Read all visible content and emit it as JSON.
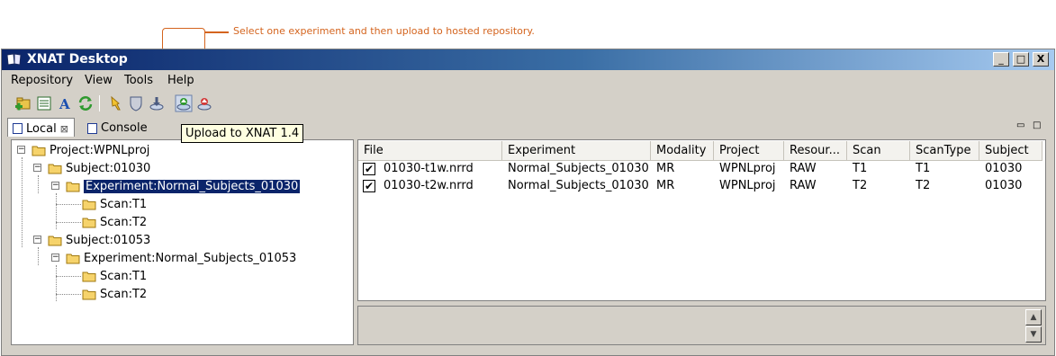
{
  "annotation": {
    "text": "Select one experiment and then upload to hosted repository."
  },
  "window": {
    "title": "XNAT Desktop",
    "controls": [
      "_",
      "□",
      "X"
    ]
  },
  "menu": [
    "Repository",
    "View",
    "Tools",
    "Help"
  ],
  "toolbar": {
    "icons": [
      "new-project-icon",
      "list-icon",
      "font-icon",
      "refresh-icon",
      "wand-icon",
      "shield-icon",
      "download-icon",
      "upload-xnat-icon",
      "upload-red-icon"
    ],
    "tooltip": "Upload to XNAT 1.4"
  },
  "tabs": [
    {
      "label": "Local",
      "close": "⊠"
    },
    {
      "label": "Console"
    }
  ],
  "view_controls": {
    "minimize": "▭",
    "maximize": "□"
  },
  "tree": [
    {
      "label": "Project:WPNLproj"
    },
    {
      "label": "Subject:01030"
    },
    {
      "label": "Experiment:Normal_Subjects_01030",
      "selected": true
    },
    {
      "label": "Scan:T1"
    },
    {
      "label": "Scan:T2"
    },
    {
      "label": "Subject:01053"
    },
    {
      "label": "Experiment:Normal_Subjects_01053"
    },
    {
      "label": "Scan:T1"
    },
    {
      "label": "Scan:T2"
    }
  ],
  "table": {
    "columns": [
      "File",
      "Experiment",
      "Modality",
      "Project",
      "Resour...",
      "Scan",
      "ScanType",
      "Subject"
    ],
    "rows": [
      {
        "checked": "✔",
        "cells": [
          "01030-t1w.nrrd",
          "Normal_Subjects_01030",
          "MR",
          "WPNLproj",
          "RAW",
          "T1",
          "T1",
          "01030"
        ]
      },
      {
        "checked": "✔",
        "cells": [
          "01030-t2w.nrrd",
          "Normal_Subjects_01030",
          "MR",
          "WPNLproj",
          "RAW",
          "T2",
          "T2",
          "01030"
        ]
      }
    ]
  },
  "scroll": {
    "up": "▲",
    "down": "▼"
  },
  "colors": {
    "accent": "#d4641e",
    "title_bar": "#0a246a",
    "selection": "#0a246a",
    "tooltip_bg": "#ffffe1"
  }
}
